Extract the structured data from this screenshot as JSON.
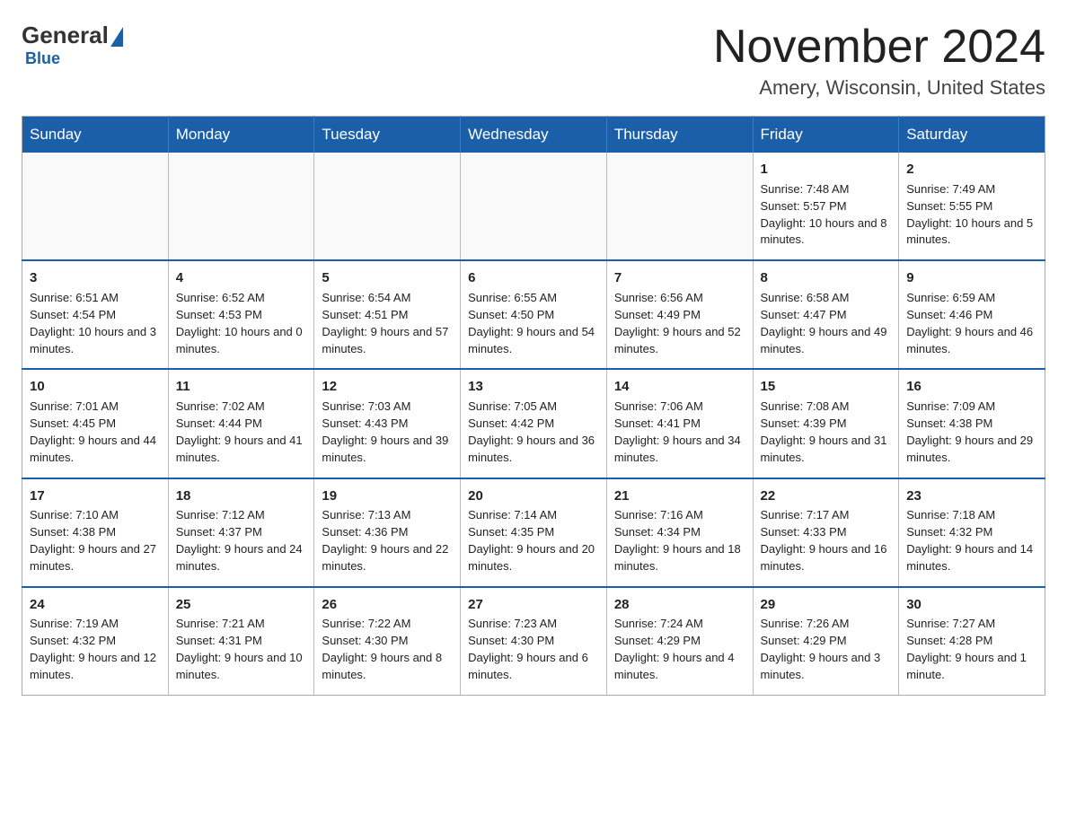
{
  "logo": {
    "general": "General",
    "blue": "Blue"
  },
  "title": {
    "month": "November 2024",
    "location": "Amery, Wisconsin, United States"
  },
  "headers": [
    "Sunday",
    "Monday",
    "Tuesday",
    "Wednesday",
    "Thursday",
    "Friday",
    "Saturday"
  ],
  "weeks": [
    [
      {
        "day": "",
        "info": ""
      },
      {
        "day": "",
        "info": ""
      },
      {
        "day": "",
        "info": ""
      },
      {
        "day": "",
        "info": ""
      },
      {
        "day": "",
        "info": ""
      },
      {
        "day": "1",
        "info": "Sunrise: 7:48 AM\nSunset: 5:57 PM\nDaylight: 10 hours and 8 minutes."
      },
      {
        "day": "2",
        "info": "Sunrise: 7:49 AM\nSunset: 5:55 PM\nDaylight: 10 hours and 5 minutes."
      }
    ],
    [
      {
        "day": "3",
        "info": "Sunrise: 6:51 AM\nSunset: 4:54 PM\nDaylight: 10 hours and 3 minutes."
      },
      {
        "day": "4",
        "info": "Sunrise: 6:52 AM\nSunset: 4:53 PM\nDaylight: 10 hours and 0 minutes."
      },
      {
        "day": "5",
        "info": "Sunrise: 6:54 AM\nSunset: 4:51 PM\nDaylight: 9 hours and 57 minutes."
      },
      {
        "day": "6",
        "info": "Sunrise: 6:55 AM\nSunset: 4:50 PM\nDaylight: 9 hours and 54 minutes."
      },
      {
        "day": "7",
        "info": "Sunrise: 6:56 AM\nSunset: 4:49 PM\nDaylight: 9 hours and 52 minutes."
      },
      {
        "day": "8",
        "info": "Sunrise: 6:58 AM\nSunset: 4:47 PM\nDaylight: 9 hours and 49 minutes."
      },
      {
        "day": "9",
        "info": "Sunrise: 6:59 AM\nSunset: 4:46 PM\nDaylight: 9 hours and 46 minutes."
      }
    ],
    [
      {
        "day": "10",
        "info": "Sunrise: 7:01 AM\nSunset: 4:45 PM\nDaylight: 9 hours and 44 minutes."
      },
      {
        "day": "11",
        "info": "Sunrise: 7:02 AM\nSunset: 4:44 PM\nDaylight: 9 hours and 41 minutes."
      },
      {
        "day": "12",
        "info": "Sunrise: 7:03 AM\nSunset: 4:43 PM\nDaylight: 9 hours and 39 minutes."
      },
      {
        "day": "13",
        "info": "Sunrise: 7:05 AM\nSunset: 4:42 PM\nDaylight: 9 hours and 36 minutes."
      },
      {
        "day": "14",
        "info": "Sunrise: 7:06 AM\nSunset: 4:41 PM\nDaylight: 9 hours and 34 minutes."
      },
      {
        "day": "15",
        "info": "Sunrise: 7:08 AM\nSunset: 4:39 PM\nDaylight: 9 hours and 31 minutes."
      },
      {
        "day": "16",
        "info": "Sunrise: 7:09 AM\nSunset: 4:38 PM\nDaylight: 9 hours and 29 minutes."
      }
    ],
    [
      {
        "day": "17",
        "info": "Sunrise: 7:10 AM\nSunset: 4:38 PM\nDaylight: 9 hours and 27 minutes."
      },
      {
        "day": "18",
        "info": "Sunrise: 7:12 AM\nSunset: 4:37 PM\nDaylight: 9 hours and 24 minutes."
      },
      {
        "day": "19",
        "info": "Sunrise: 7:13 AM\nSunset: 4:36 PM\nDaylight: 9 hours and 22 minutes."
      },
      {
        "day": "20",
        "info": "Sunrise: 7:14 AM\nSunset: 4:35 PM\nDaylight: 9 hours and 20 minutes."
      },
      {
        "day": "21",
        "info": "Sunrise: 7:16 AM\nSunset: 4:34 PM\nDaylight: 9 hours and 18 minutes."
      },
      {
        "day": "22",
        "info": "Sunrise: 7:17 AM\nSunset: 4:33 PM\nDaylight: 9 hours and 16 minutes."
      },
      {
        "day": "23",
        "info": "Sunrise: 7:18 AM\nSunset: 4:32 PM\nDaylight: 9 hours and 14 minutes."
      }
    ],
    [
      {
        "day": "24",
        "info": "Sunrise: 7:19 AM\nSunset: 4:32 PM\nDaylight: 9 hours and 12 minutes."
      },
      {
        "day": "25",
        "info": "Sunrise: 7:21 AM\nSunset: 4:31 PM\nDaylight: 9 hours and 10 minutes."
      },
      {
        "day": "26",
        "info": "Sunrise: 7:22 AM\nSunset: 4:30 PM\nDaylight: 9 hours and 8 minutes."
      },
      {
        "day": "27",
        "info": "Sunrise: 7:23 AM\nSunset: 4:30 PM\nDaylight: 9 hours and 6 minutes."
      },
      {
        "day": "28",
        "info": "Sunrise: 7:24 AM\nSunset: 4:29 PM\nDaylight: 9 hours and 4 minutes."
      },
      {
        "day": "29",
        "info": "Sunrise: 7:26 AM\nSunset: 4:29 PM\nDaylight: 9 hours and 3 minutes."
      },
      {
        "day": "30",
        "info": "Sunrise: 7:27 AM\nSunset: 4:28 PM\nDaylight: 9 hours and 1 minute."
      }
    ]
  ]
}
